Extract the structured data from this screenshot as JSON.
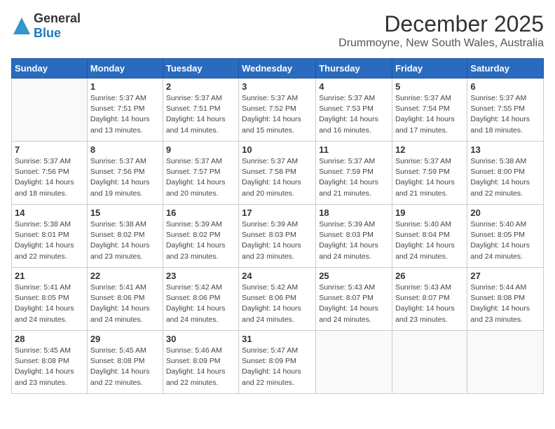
{
  "header": {
    "logo_general": "General",
    "logo_blue": "Blue",
    "title": "December 2025",
    "subtitle": "Drummoyne, New South Wales, Australia"
  },
  "days_of_week": [
    "Sunday",
    "Monday",
    "Tuesday",
    "Wednesday",
    "Thursday",
    "Friday",
    "Saturday"
  ],
  "weeks": [
    [
      {
        "day": "",
        "sunrise": "",
        "sunset": "",
        "daylight": ""
      },
      {
        "day": "1",
        "sunrise": "Sunrise: 5:37 AM",
        "sunset": "Sunset: 7:51 PM",
        "daylight": "Daylight: 14 hours and 13 minutes."
      },
      {
        "day": "2",
        "sunrise": "Sunrise: 5:37 AM",
        "sunset": "Sunset: 7:51 PM",
        "daylight": "Daylight: 14 hours and 14 minutes."
      },
      {
        "day": "3",
        "sunrise": "Sunrise: 5:37 AM",
        "sunset": "Sunset: 7:52 PM",
        "daylight": "Daylight: 14 hours and 15 minutes."
      },
      {
        "day": "4",
        "sunrise": "Sunrise: 5:37 AM",
        "sunset": "Sunset: 7:53 PM",
        "daylight": "Daylight: 14 hours and 16 minutes."
      },
      {
        "day": "5",
        "sunrise": "Sunrise: 5:37 AM",
        "sunset": "Sunset: 7:54 PM",
        "daylight": "Daylight: 14 hours and 17 minutes."
      },
      {
        "day": "6",
        "sunrise": "Sunrise: 5:37 AM",
        "sunset": "Sunset: 7:55 PM",
        "daylight": "Daylight: 14 hours and 18 minutes."
      }
    ],
    [
      {
        "day": "7",
        "sunrise": "Sunrise: 5:37 AM",
        "sunset": "Sunset: 7:56 PM",
        "daylight": "Daylight: 14 hours and 18 minutes."
      },
      {
        "day": "8",
        "sunrise": "Sunrise: 5:37 AM",
        "sunset": "Sunset: 7:56 PM",
        "daylight": "Daylight: 14 hours and 19 minutes."
      },
      {
        "day": "9",
        "sunrise": "Sunrise: 5:37 AM",
        "sunset": "Sunset: 7:57 PM",
        "daylight": "Daylight: 14 hours and 20 minutes."
      },
      {
        "day": "10",
        "sunrise": "Sunrise: 5:37 AM",
        "sunset": "Sunset: 7:58 PM",
        "daylight": "Daylight: 14 hours and 20 minutes."
      },
      {
        "day": "11",
        "sunrise": "Sunrise: 5:37 AM",
        "sunset": "Sunset: 7:59 PM",
        "daylight": "Daylight: 14 hours and 21 minutes."
      },
      {
        "day": "12",
        "sunrise": "Sunrise: 5:37 AM",
        "sunset": "Sunset: 7:59 PM",
        "daylight": "Daylight: 14 hours and 21 minutes."
      },
      {
        "day": "13",
        "sunrise": "Sunrise: 5:38 AM",
        "sunset": "Sunset: 8:00 PM",
        "daylight": "Daylight: 14 hours and 22 minutes."
      }
    ],
    [
      {
        "day": "14",
        "sunrise": "Sunrise: 5:38 AM",
        "sunset": "Sunset: 8:01 PM",
        "daylight": "Daylight: 14 hours and 22 minutes."
      },
      {
        "day": "15",
        "sunrise": "Sunrise: 5:38 AM",
        "sunset": "Sunset: 8:02 PM",
        "daylight": "Daylight: 14 hours and 23 minutes."
      },
      {
        "day": "16",
        "sunrise": "Sunrise: 5:39 AM",
        "sunset": "Sunset: 8:02 PM",
        "daylight": "Daylight: 14 hours and 23 minutes."
      },
      {
        "day": "17",
        "sunrise": "Sunrise: 5:39 AM",
        "sunset": "Sunset: 8:03 PM",
        "daylight": "Daylight: 14 hours and 23 minutes."
      },
      {
        "day": "18",
        "sunrise": "Sunrise: 5:39 AM",
        "sunset": "Sunset: 8:03 PM",
        "daylight": "Daylight: 14 hours and 24 minutes."
      },
      {
        "day": "19",
        "sunrise": "Sunrise: 5:40 AM",
        "sunset": "Sunset: 8:04 PM",
        "daylight": "Daylight: 14 hours and 24 minutes."
      },
      {
        "day": "20",
        "sunrise": "Sunrise: 5:40 AM",
        "sunset": "Sunset: 8:05 PM",
        "daylight": "Daylight: 14 hours and 24 minutes."
      }
    ],
    [
      {
        "day": "21",
        "sunrise": "Sunrise: 5:41 AM",
        "sunset": "Sunset: 8:05 PM",
        "daylight": "Daylight: 14 hours and 24 minutes."
      },
      {
        "day": "22",
        "sunrise": "Sunrise: 5:41 AM",
        "sunset": "Sunset: 8:06 PM",
        "daylight": "Daylight: 14 hours and 24 minutes."
      },
      {
        "day": "23",
        "sunrise": "Sunrise: 5:42 AM",
        "sunset": "Sunset: 8:06 PM",
        "daylight": "Daylight: 14 hours and 24 minutes."
      },
      {
        "day": "24",
        "sunrise": "Sunrise: 5:42 AM",
        "sunset": "Sunset: 8:06 PM",
        "daylight": "Daylight: 14 hours and 24 minutes."
      },
      {
        "day": "25",
        "sunrise": "Sunrise: 5:43 AM",
        "sunset": "Sunset: 8:07 PM",
        "daylight": "Daylight: 14 hours and 24 minutes."
      },
      {
        "day": "26",
        "sunrise": "Sunrise: 5:43 AM",
        "sunset": "Sunset: 8:07 PM",
        "daylight": "Daylight: 14 hours and 23 minutes."
      },
      {
        "day": "27",
        "sunrise": "Sunrise: 5:44 AM",
        "sunset": "Sunset: 8:08 PM",
        "daylight": "Daylight: 14 hours and 23 minutes."
      }
    ],
    [
      {
        "day": "28",
        "sunrise": "Sunrise: 5:45 AM",
        "sunset": "Sunset: 8:08 PM",
        "daylight": "Daylight: 14 hours and 23 minutes."
      },
      {
        "day": "29",
        "sunrise": "Sunrise: 5:45 AM",
        "sunset": "Sunset: 8:08 PM",
        "daylight": "Daylight: 14 hours and 22 minutes."
      },
      {
        "day": "30",
        "sunrise": "Sunrise: 5:46 AM",
        "sunset": "Sunset: 8:09 PM",
        "daylight": "Daylight: 14 hours and 22 minutes."
      },
      {
        "day": "31",
        "sunrise": "Sunrise: 5:47 AM",
        "sunset": "Sunset: 8:09 PM",
        "daylight": "Daylight: 14 hours and 22 minutes."
      },
      {
        "day": "",
        "sunrise": "",
        "sunset": "",
        "daylight": ""
      },
      {
        "day": "",
        "sunrise": "",
        "sunset": "",
        "daylight": ""
      },
      {
        "day": "",
        "sunrise": "",
        "sunset": "",
        "daylight": ""
      }
    ]
  ]
}
